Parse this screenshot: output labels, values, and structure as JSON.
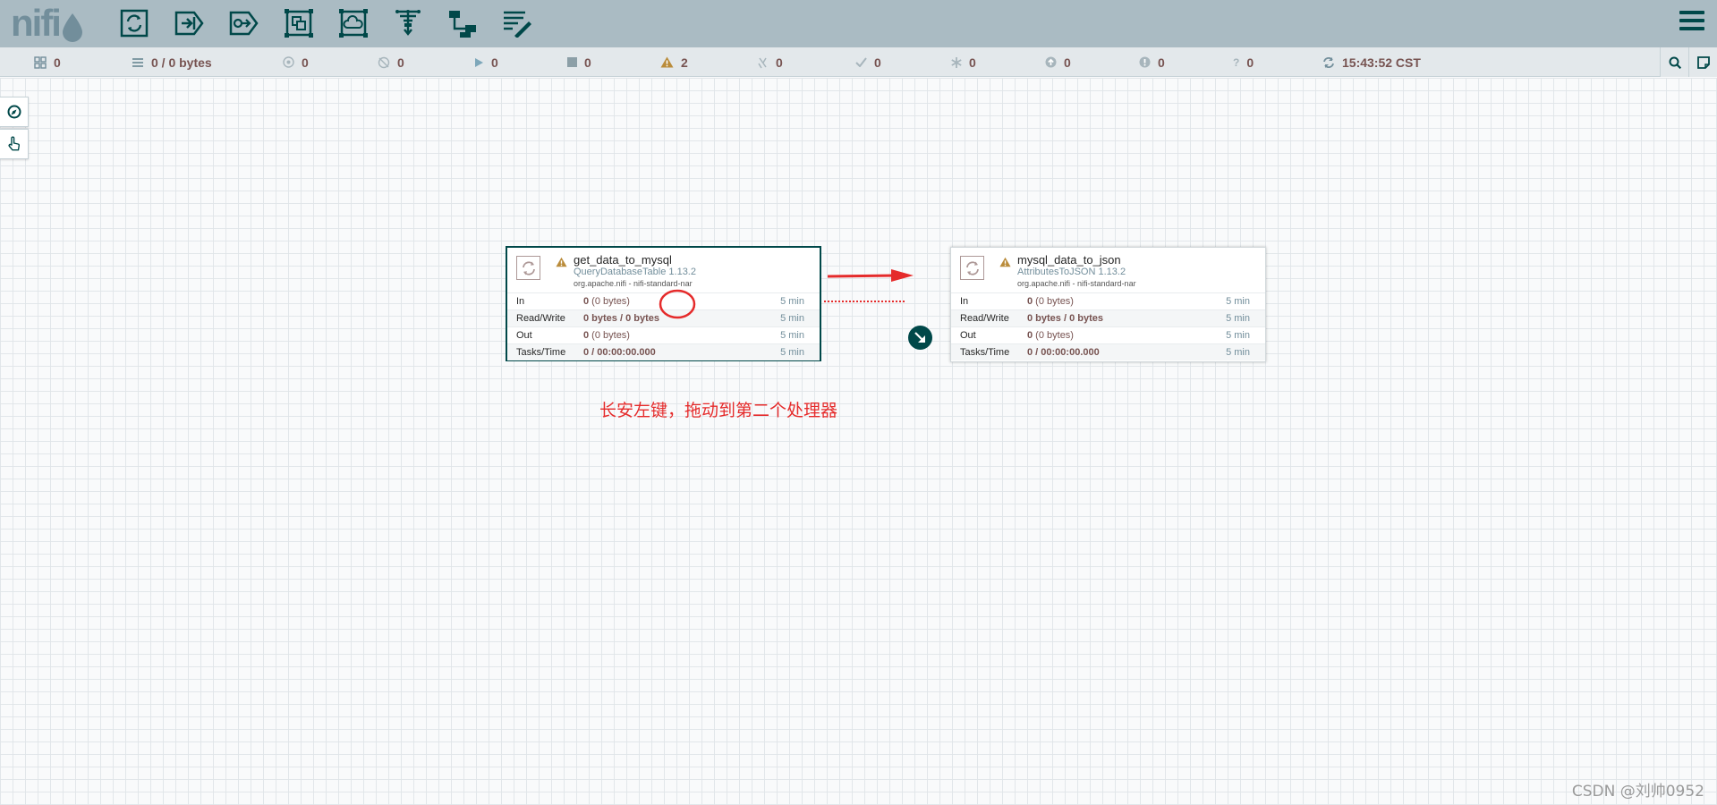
{
  "header": {
    "logo_text": "nifi",
    "toolbar": [
      {
        "id": "processor",
        "icon": "processor-icon"
      },
      {
        "id": "input-port",
        "icon": "input-port-icon"
      },
      {
        "id": "output-port",
        "icon": "output-port-icon"
      },
      {
        "id": "process-group",
        "icon": "process-group-icon"
      },
      {
        "id": "remote-process-group",
        "icon": "remote-process-group-icon"
      },
      {
        "id": "funnel",
        "icon": "funnel-icon"
      },
      {
        "id": "template",
        "icon": "template-icon"
      },
      {
        "id": "label",
        "icon": "label-icon"
      }
    ]
  },
  "status": {
    "active_threads": "0",
    "queued": "0 / 0 bytes",
    "transmitting": "0",
    "not_transmitting": "0",
    "running": "0",
    "stopped": "0",
    "invalid": "2",
    "disabled": "0",
    "up_to_date": "0",
    "locally_modified": "0",
    "stale": "0",
    "locally_modified_and_stale": "0",
    "sync_failure": "0",
    "last_refreshed": "15:43:52 CST"
  },
  "processors": [
    {
      "name": "get_data_to_mysql",
      "type": "QueryDatabaseTable 1.13.2",
      "bundle": "org.apache.nifi - nifi-standard-nar",
      "rows": [
        {
          "label": "In",
          "value_bold": "0",
          "value_rest": " (0 bytes)",
          "window": "5 min"
        },
        {
          "label": "Read/Write",
          "value_bold": "0 bytes / 0 bytes",
          "value_rest": "",
          "window": "5 min"
        },
        {
          "label": "Out",
          "value_bold": "0",
          "value_rest": " (0 bytes)",
          "window": "5 min"
        },
        {
          "label": "Tasks/Time",
          "value_bold": "0 / 00:00:00.000",
          "value_rest": "",
          "window": "5 min"
        }
      ]
    },
    {
      "name": "mysql_data_to_json",
      "type": "AttributesToJSON 1.13.2",
      "bundle": "org.apache.nifi - nifi-standard-nar",
      "rows": [
        {
          "label": "In",
          "value_bold": "0",
          "value_rest": " (0 bytes)",
          "window": "5 min"
        },
        {
          "label": "Read/Write",
          "value_bold": "0 bytes / 0 bytes",
          "value_rest": "",
          "window": "5 min"
        },
        {
          "label": "Out",
          "value_bold": "0",
          "value_rest": " (0 bytes)",
          "window": "5 min"
        },
        {
          "label": "Tasks/Time",
          "value_bold": "0 / 00:00:00.000",
          "value_rest": "",
          "window": "5 min"
        }
      ]
    }
  ],
  "annotation": "长安左键，拖动到第二个处理器",
  "watermark": "CSDN @刘帅0952",
  "colors": {
    "header_bg": "#aabbc3",
    "toolbar_icon": "#004849",
    "status_value": "#775351",
    "annotation_red": "#e52b2b",
    "warning": "#ba8c3b"
  }
}
